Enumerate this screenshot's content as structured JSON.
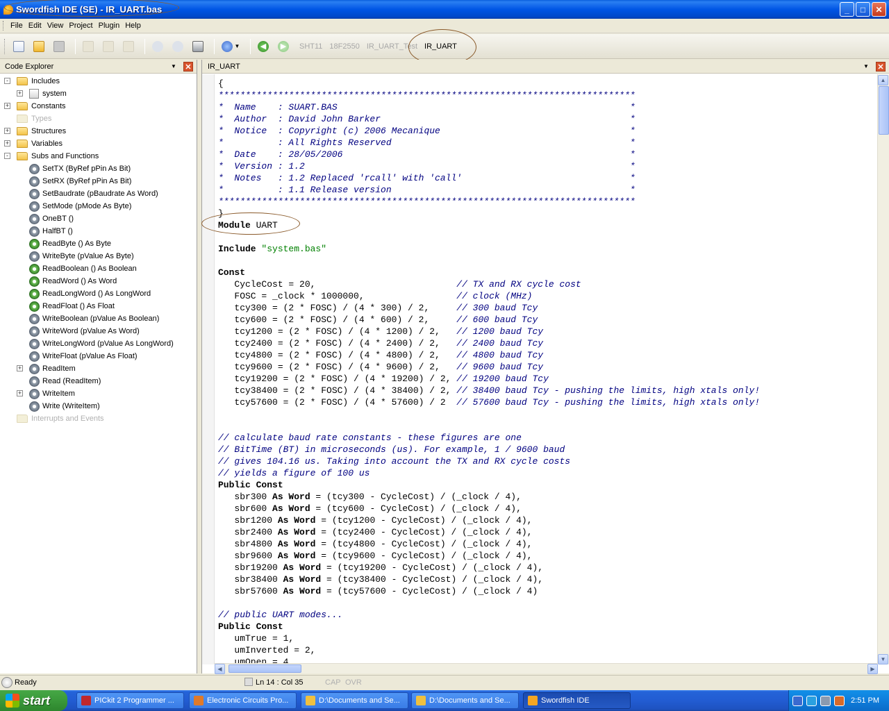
{
  "window": {
    "title": "Swordfish IDE (SE) - IR_UART.bas",
    "controls": {
      "minimize": "_",
      "maximize": "□",
      "close": "✕"
    }
  },
  "menu": [
    "File",
    "Edit",
    "View",
    "Project",
    "Plugin",
    "Help"
  ],
  "toolbar": {
    "icons": [
      "new-file-icon",
      "open-folder-icon",
      "save-icon",
      "cut-icon",
      "copy-icon",
      "paste-icon",
      "undo-icon",
      "redo-icon",
      "print-icon",
      "compile-program-icon",
      "back-arrow-icon",
      "forward-arrow-icon"
    ],
    "doc_tabs": [
      "SHT11",
      "18F2550",
      "IR_UART_Test",
      "IR_UART"
    ]
  },
  "code_explorer": {
    "title": "Code Explorer",
    "nodes": [
      {
        "label": "Includes",
        "kind": "folder",
        "expander": "-"
      },
      {
        "label": "system",
        "kind": "system",
        "expander": "+"
      },
      {
        "label": "Constants",
        "kind": "folder",
        "expander": "+"
      },
      {
        "label": "Types",
        "kind": "folder-faded",
        "expander": ""
      },
      {
        "label": "Structures",
        "kind": "folder",
        "expander": "+"
      },
      {
        "label": "Variables",
        "kind": "folder",
        "expander": "+"
      },
      {
        "label": "Subs and Functions",
        "kind": "folder",
        "expander": "-"
      },
      {
        "label": "SetTX (ByRef pPin As Bit)",
        "kind": "gear",
        "expander": ""
      },
      {
        "label": "SetRX (ByRef pPin As Bit)",
        "kind": "gear",
        "expander": ""
      },
      {
        "label": "SetBaudrate (pBaudrate As Word)",
        "kind": "gear",
        "expander": ""
      },
      {
        "label": "SetMode (pMode As Byte)",
        "kind": "gear",
        "expander": ""
      },
      {
        "label": "OneBT ()",
        "kind": "gear",
        "expander": ""
      },
      {
        "label": "HalfBT ()",
        "kind": "gear",
        "expander": ""
      },
      {
        "label": "ReadByte () As Byte",
        "kind": "gear-green",
        "expander": ""
      },
      {
        "label": "WriteByte (pValue As Byte)",
        "kind": "gear",
        "expander": ""
      },
      {
        "label": "ReadBoolean () As Boolean",
        "kind": "gear-green",
        "expander": ""
      },
      {
        "label": "ReadWord () As Word",
        "kind": "gear-green",
        "expander": ""
      },
      {
        "label": "ReadLongWord () As LongWord",
        "kind": "gear-green",
        "expander": ""
      },
      {
        "label": "ReadFloat () As Float",
        "kind": "gear-green",
        "expander": ""
      },
      {
        "label": "WriteBoolean (pValue As Boolean)",
        "kind": "gear",
        "expander": ""
      },
      {
        "label": "WriteWord (pValue As Word)",
        "kind": "gear",
        "expander": ""
      },
      {
        "label": "WriteLongWord (pValue As LongWord)",
        "kind": "gear",
        "expander": ""
      },
      {
        "label": "WriteFloat (pValue As Float)",
        "kind": "gear",
        "expander": ""
      },
      {
        "label": "ReadItem",
        "kind": "gear",
        "expander": "+"
      },
      {
        "label": "Read (ReadItem)",
        "kind": "gear",
        "expander": ""
      },
      {
        "label": "WriteItem",
        "kind": "gear",
        "expander": "+"
      },
      {
        "label": "Write (WriteItem)",
        "kind": "gear",
        "expander": ""
      },
      {
        "label": "Interrupts and Events",
        "kind": "folder-faded",
        "expander": ""
      }
    ]
  },
  "editor": {
    "tab_title": "IR_UART",
    "lines": [
      [
        [
          "{",
          ""
        ]
      ],
      [
        [
          "*****************************************************************************",
          "c"
        ]
      ],
      [
        [
          "*  Name    : SUART.BAS                                                      *",
          "c"
        ]
      ],
      [
        [
          "*  Author  : David John Barker                                              *",
          "c"
        ]
      ],
      [
        [
          "*  Notice  : Copyright (c) 2006 Mecanique                                   *",
          "c"
        ]
      ],
      [
        [
          "*          : All Rights Reserved                                            *",
          "c"
        ]
      ],
      [
        [
          "*  Date    : 28/05/2006                                                     *",
          "c"
        ]
      ],
      [
        [
          "*  Version : 1.2                                                            *",
          "c"
        ]
      ],
      [
        [
          "*  Notes   : 1.2 Replaced 'rcall' with 'call'                               *",
          "c"
        ]
      ],
      [
        [
          "*          : 1.1 Release version                                            *",
          "c"
        ]
      ],
      [
        [
          "*****************************************************************************",
          "c"
        ]
      ],
      [
        [
          "}",
          ""
        ]
      ],
      [
        [
          "Module",
          "k"
        ],
        [
          " UART",
          ""
        ]
      ],
      [
        [
          "",
          ""
        ]
      ],
      [
        [
          "Include",
          "k"
        ],
        [
          " ",
          ""
        ],
        [
          "\"system.bas\"",
          "s"
        ]
      ],
      [
        [
          "",
          ""
        ]
      ],
      [
        [
          "Const",
          "k"
        ]
      ],
      [
        [
          "   CycleCost = 20,                          ",
          ""
        ],
        [
          "// TX and RX cycle cost",
          "c"
        ]
      ],
      [
        [
          "   FOSC = _clock * 1000000,                 ",
          ""
        ],
        [
          "// clock (MHz)",
          "c"
        ]
      ],
      [
        [
          "   tcy300 = (2 * FOSC) / (4 * 300) / 2,     ",
          ""
        ],
        [
          "// 300 baud Tcy",
          "c"
        ]
      ],
      [
        [
          "   tcy600 = (2 * FOSC) / (4 * 600) / 2,     ",
          ""
        ],
        [
          "// 600 baud Tcy",
          "c"
        ]
      ],
      [
        [
          "   tcy1200 = (2 * FOSC) / (4 * 1200) / 2,   ",
          ""
        ],
        [
          "// 1200 baud Tcy",
          "c"
        ]
      ],
      [
        [
          "   tcy2400 = (2 * FOSC) / (4 * 2400) / 2,   ",
          ""
        ],
        [
          "// 2400 baud Tcy",
          "c"
        ]
      ],
      [
        [
          "   tcy4800 = (2 * FOSC) / (4 * 4800) / 2,   ",
          ""
        ],
        [
          "// 4800 baud Tcy",
          "c"
        ]
      ],
      [
        [
          "   tcy9600 = (2 * FOSC) / (4 * 9600) / 2,   ",
          ""
        ],
        [
          "// 9600 baud Tcy",
          "c"
        ]
      ],
      [
        [
          "   tcy19200 = (2 * FOSC) / (4 * 19200) / 2, ",
          ""
        ],
        [
          "// 19200 baud Tcy",
          "c"
        ]
      ],
      [
        [
          "   tcy38400 = (2 * FOSC) / (4 * 38400) / 2, ",
          ""
        ],
        [
          "// 38400 baud Tcy - pushing the limits, high xtals only!",
          "c"
        ]
      ],
      [
        [
          "   tcy57600 = (2 * FOSC) / (4 * 57600) / 2  ",
          ""
        ],
        [
          "// 57600 baud Tcy - pushing the limits, high xtals only!",
          "c"
        ]
      ],
      [
        [
          "",
          ""
        ]
      ],
      [
        [
          "",
          ""
        ]
      ],
      [
        [
          "// calculate baud rate constants - these figures are one",
          "c"
        ]
      ],
      [
        [
          "// BitTime (BT) in microseconds (us). For example, 1 / 9600 baud",
          "c"
        ]
      ],
      [
        [
          "// gives 104.16 us. Taking into account the TX and RX cycle costs",
          "c"
        ]
      ],
      [
        [
          "// yields a figure of 100 us",
          "c"
        ]
      ],
      [
        [
          "Public Const",
          "k"
        ]
      ],
      [
        [
          "   sbr300 ",
          ""
        ],
        [
          "As Word",
          "k"
        ],
        [
          " = (tcy300 - CycleCost) / (_clock / 4),",
          ""
        ]
      ],
      [
        [
          "   sbr600 ",
          ""
        ],
        [
          "As Word",
          "k"
        ],
        [
          " = (tcy600 - CycleCost) / (_clock / 4),",
          ""
        ]
      ],
      [
        [
          "   sbr1200 ",
          ""
        ],
        [
          "As Word",
          "k"
        ],
        [
          " = (tcy1200 - CycleCost) / (_clock / 4),",
          ""
        ]
      ],
      [
        [
          "   sbr2400 ",
          ""
        ],
        [
          "As Word",
          "k"
        ],
        [
          " = (tcy2400 - CycleCost) / (_clock / 4),",
          ""
        ]
      ],
      [
        [
          "   sbr4800 ",
          ""
        ],
        [
          "As Word",
          "k"
        ],
        [
          " = (tcy4800 - CycleCost) / (_clock / 4),",
          ""
        ]
      ],
      [
        [
          "   sbr9600 ",
          ""
        ],
        [
          "As Word",
          "k"
        ],
        [
          " = (tcy9600 - CycleCost) / (_clock / 4),",
          ""
        ]
      ],
      [
        [
          "   sbr19200 ",
          ""
        ],
        [
          "As Word",
          "k"
        ],
        [
          " = (tcy19200 - CycleCost) / (_clock / 4),",
          ""
        ]
      ],
      [
        [
          "   sbr38400 ",
          ""
        ],
        [
          "As Word",
          "k"
        ],
        [
          " = (tcy38400 - CycleCost) / (_clock / 4),",
          ""
        ]
      ],
      [
        [
          "   sbr57600 ",
          ""
        ],
        [
          "As Word",
          "k"
        ],
        [
          " = (tcy57600 - CycleCost) / (_clock / 4)",
          ""
        ]
      ],
      [
        [
          "",
          ""
        ]
      ],
      [
        [
          "// public UART modes...",
          "c"
        ]
      ],
      [
        [
          "Public Const",
          "k"
        ]
      ],
      [
        [
          "   umTrue = 1,",
          ""
        ]
      ],
      [
        [
          "   umInverted = 2,",
          ""
        ]
      ],
      [
        [
          "   umOpen = 4,",
          ""
        ]
      ]
    ]
  },
  "status": {
    "ready": "Ready",
    "position": "Ln 14 : Col 35",
    "cap": "CAP",
    "ovr": "OVR"
  },
  "taskbar": {
    "start": "start",
    "tasks": [
      {
        "label": "PICkit 2 Programmer ...",
        "color": "#c0282d"
      },
      {
        "label": "Electronic Circuits Pro...",
        "color": "#e07a2a"
      },
      {
        "label": "D:\\Documents and Se...",
        "color": "#f0c040"
      },
      {
        "label": "D:\\Documents and Se...",
        "color": "#f0c040"
      },
      {
        "label": "Swordfish IDE",
        "color": "#f5a623"
      }
    ],
    "clock": "2:51 PM"
  }
}
